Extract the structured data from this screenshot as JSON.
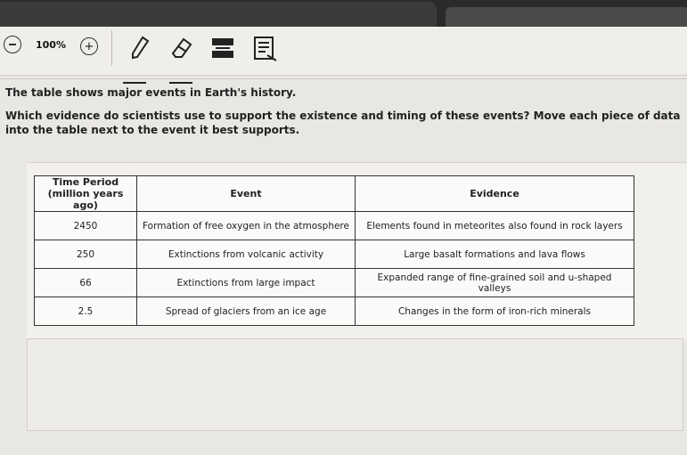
{
  "toolbar": {
    "zoom_level": "100%",
    "tools": [
      {
        "name": "pencil-icon"
      },
      {
        "name": "eraser-icon"
      },
      {
        "name": "line-reader-icon"
      },
      {
        "name": "notepad-icon"
      }
    ]
  },
  "prompt": {
    "intro": "The table shows major events in Earth's history.",
    "question": "Which evidence do scientists use to support the existence and timing of these events? Move each piece of data into the table next to the event it best supports."
  },
  "table": {
    "headers": [
      "Time Period (million years ago)",
      "Event",
      "Evidence"
    ],
    "rows": [
      {
        "time": "2450",
        "event": "Formation of free oxygen in the atmosphere",
        "evidence": "Elements found in meteorites also found in rock layers"
      },
      {
        "time": "250",
        "event": "Extinctions from volcanic activity",
        "evidence": "Large basalt formations and lava flows"
      },
      {
        "time": "66",
        "event": "Extinctions from large impact",
        "evidence": "Expanded range of fine-grained soil and u-shaped valleys"
      },
      {
        "time": "2.5",
        "event": "Spread of glaciers from an ice age",
        "evidence": "Changes in the form of iron-rich minerals"
      }
    ]
  }
}
